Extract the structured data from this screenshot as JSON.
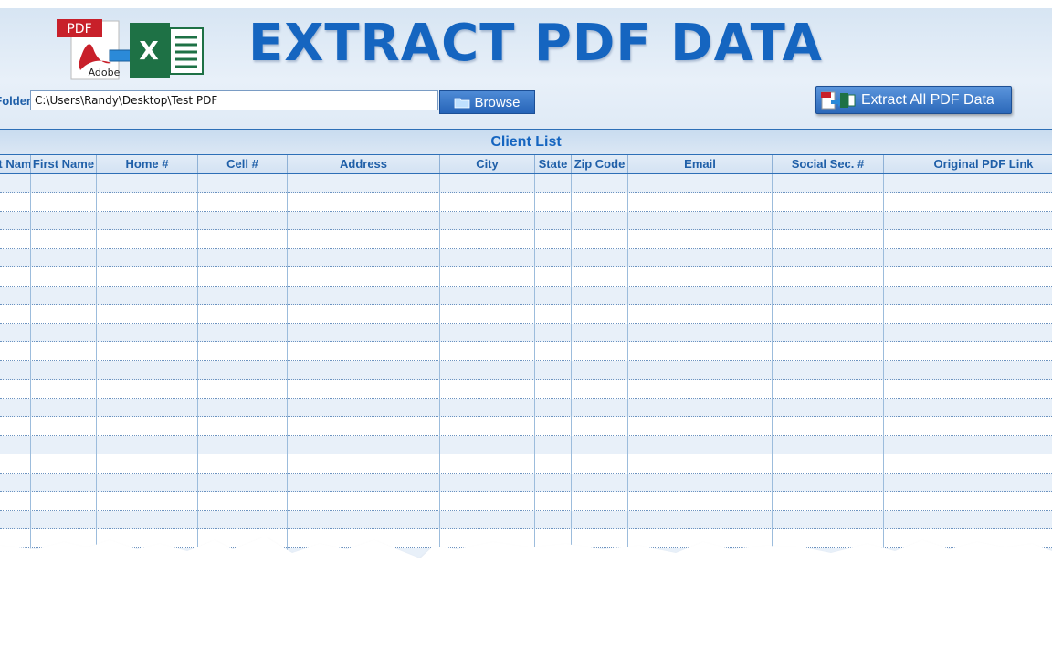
{
  "header": {
    "title": "EXTRACT PDF DATA",
    "logo_pdf_text": "PDF",
    "logo_adobe_text": "Adobe",
    "logo_excel_text": "X"
  },
  "folder": {
    "label": "Folder:",
    "path": "C:\\Users\\Randy\\Desktop\\Test PDF",
    "browse_label": "Browse"
  },
  "extract_button": {
    "label": "Extract All PDF Data"
  },
  "table": {
    "caption": "Client List",
    "columns": [
      "Last Name",
      "First Name",
      "Home #",
      "Cell #",
      "Address",
      "City",
      "State",
      "Zip Code",
      "Email",
      "Social Sec. #",
      "Original PDF Link"
    ],
    "rows": []
  },
  "colors": {
    "accent": "#1565c0",
    "header_bg": "#dfeaf6",
    "alt_row": "#e8f0f9",
    "button": "#2b68b9",
    "excel_green": "#1e7145",
    "pdf_red": "#c8202a"
  }
}
